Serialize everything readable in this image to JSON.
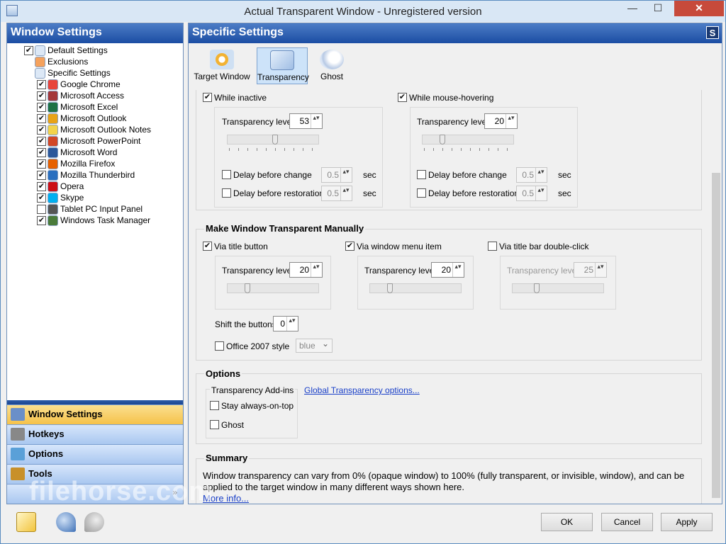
{
  "window": {
    "title": "Actual Transparent Window - Unregistered version",
    "min_glyph": "—",
    "max_glyph": "☐",
    "close_glyph": "✕"
  },
  "left_panel": {
    "title": "Window Settings",
    "tree": [
      {
        "label": "Default Settings",
        "checked": true,
        "level": 0
      },
      {
        "label": "Exclusions",
        "level": 0
      },
      {
        "label": "Specific Settings",
        "level": 0
      },
      {
        "label": "Google Chrome",
        "checked": true,
        "level": 1,
        "icon": "chrome-icon",
        "color": "#e8453c"
      },
      {
        "label": "Microsoft Access",
        "checked": true,
        "level": 1,
        "icon": "access-icon",
        "color": "#a4373a"
      },
      {
        "label": "Microsoft Excel",
        "checked": true,
        "level": 1,
        "icon": "excel-icon",
        "color": "#1e7145"
      },
      {
        "label": "Microsoft Outlook",
        "checked": true,
        "level": 1,
        "icon": "outlook-icon",
        "color": "#e8a317"
      },
      {
        "label": "Microsoft Outlook Notes",
        "checked": true,
        "level": 1,
        "icon": "notes-icon",
        "color": "#f3d34a"
      },
      {
        "label": "Microsoft PowerPoint",
        "checked": true,
        "level": 1,
        "icon": "powerpoint-icon",
        "color": "#d24726"
      },
      {
        "label": "Microsoft Word",
        "checked": true,
        "level": 1,
        "icon": "word-icon",
        "color": "#2b579a"
      },
      {
        "label": "Mozilla Firefox",
        "checked": true,
        "level": 1,
        "icon": "firefox-icon",
        "color": "#e66000"
      },
      {
        "label": "Mozilla Thunderbird",
        "checked": true,
        "level": 1,
        "icon": "thunderbird-icon",
        "color": "#2a6fbf"
      },
      {
        "label": "Opera",
        "checked": true,
        "level": 1,
        "icon": "opera-icon",
        "color": "#cc0f16"
      },
      {
        "label": "Skype",
        "checked": true,
        "level": 1,
        "icon": "skype-icon",
        "color": "#00aff0"
      },
      {
        "label": "Tablet PC Input Panel",
        "checked": false,
        "level": 1,
        "icon": "keyboard-icon",
        "color": "#555555"
      },
      {
        "label": "Windows Task Manager",
        "checked": true,
        "level": 1,
        "icon": "taskmgr-icon",
        "color": "#4a7b3a"
      }
    ],
    "nav": [
      {
        "label": "Window Settings",
        "active": true,
        "color": "#6a8fc8"
      },
      {
        "label": "Hotkeys",
        "active": false,
        "color": "#888888"
      },
      {
        "label": "Options",
        "active": false,
        "color": "#5aa0d8"
      },
      {
        "label": "Tools",
        "active": false,
        "color": "#c8902a"
      }
    ],
    "chevron": "»"
  },
  "right_panel": {
    "title": "Specific Settings",
    "badge": "S",
    "tabs": [
      {
        "label": "Target Window",
        "selected": false
      },
      {
        "label": "Transparency",
        "selected": true
      },
      {
        "label": "Ghost",
        "selected": false
      }
    ],
    "inactive": {
      "label": "While inactive",
      "checked": true,
      "level_label": "Transparency level",
      "level": "53",
      "slider_pct": 53,
      "delay_change": "Delay before change",
      "delay_change_value": "0.5",
      "delay_restore": "Delay before restoration",
      "delay_restore_value": "0.5",
      "sec": "sec"
    },
    "hover": {
      "label": "While mouse-hovering",
      "checked": true,
      "level_label": "Transparency level",
      "level": "20",
      "slider_pct": 20,
      "delay_change": "Delay before change",
      "delay_change_value": "0.5",
      "delay_restore": "Delay before restoration",
      "delay_restore_value": "0.5",
      "sec": "sec"
    },
    "manual": {
      "title": "Make Window Transparent Manually",
      "title_button": {
        "label": "Via title button",
        "checked": true,
        "level_label": "Transparency level",
        "level": "20",
        "slider_pct": 20
      },
      "menu_item": {
        "label": "Via window menu item",
        "checked": true,
        "level_label": "Transparency level",
        "level": "20",
        "slider_pct": 20
      },
      "dblclick": {
        "label": "Via title bar double-click",
        "checked": false,
        "level_label": "Transparency level",
        "level": "25",
        "slider_pct": 25
      },
      "shift_label": "Shift the buttons",
      "shift_value": "0",
      "office_label": "Office 2007 style",
      "office_value": "blue"
    },
    "options": {
      "title": "Options",
      "addins_title": "Transparency Add-ins",
      "stay_on_top": "Stay always-on-top",
      "ghost": "Ghost",
      "global_link": "Global Transparency options..."
    },
    "summary": {
      "title": "Summary",
      "text": "Window transparency can vary from 0% (opaque window) to 100% (fully transparent, or invisible, window), and can be applied to the target window in many different ways shown here.",
      "more": "More info..."
    }
  },
  "buttons": {
    "ok": "OK",
    "cancel": "Cancel",
    "apply": "Apply"
  },
  "watermark": "filehorse.com"
}
